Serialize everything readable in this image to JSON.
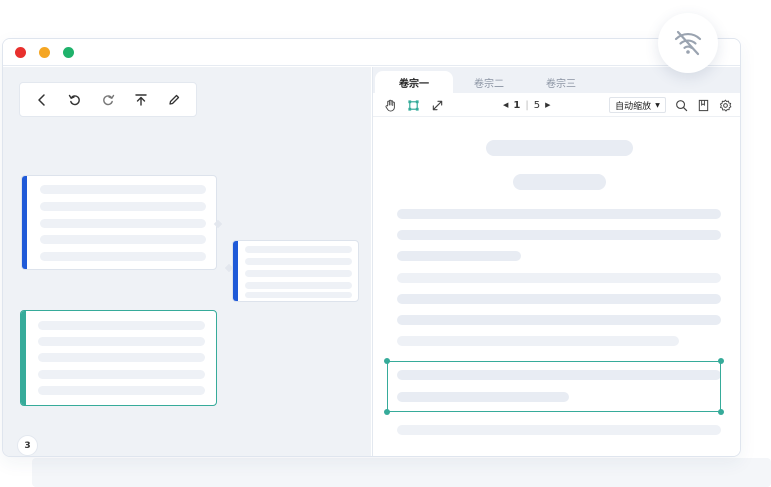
{
  "window": {
    "traffic_lights": [
      "close",
      "minimize",
      "maximize"
    ],
    "colors": {
      "close": "#e8302d",
      "minimize": "#f5a623",
      "maximize": "#1fb26b"
    }
  },
  "toolbar": {
    "buttons": [
      "back-icon",
      "undo-icon",
      "redo-icon",
      "upload-icon",
      "edit-icon"
    ]
  },
  "left_pane": {
    "page_number": "3",
    "accent_colors": {
      "card": "#1f5ad8",
      "selected": "#36ab9a"
    }
  },
  "tabs": [
    {
      "label": "卷宗一",
      "active": true
    },
    {
      "label": "卷宗二",
      "active": false
    },
    {
      "label": "卷宗三",
      "active": false
    }
  ],
  "viewer": {
    "tools": [
      "hand-icon",
      "crop-icon",
      "resize-icon"
    ],
    "current_page": "1",
    "separator": "|",
    "total_pages": "5",
    "zoom_label": "自动缩放",
    "right_icons": [
      "search-icon",
      "bookmark-icon",
      "settings-icon"
    ]
  },
  "status": {
    "offline_icon": "wifi-off-icon",
    "selection_color": "#36ab9a"
  }
}
